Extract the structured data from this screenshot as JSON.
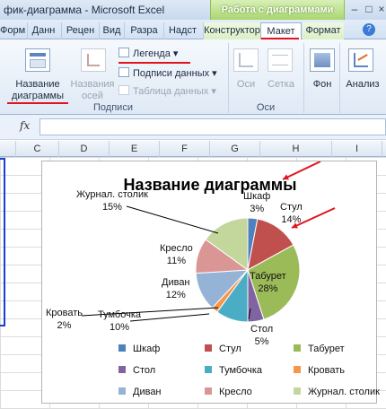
{
  "window": {
    "title": "фик-диаграмма  -  Microsoft Excel",
    "context_group": "Работа с диаграммами"
  },
  "tabs": [
    "Форм",
    "Данн",
    "Рецен",
    "Вид",
    "Разра",
    "Надст",
    "Конструктор",
    "Макет",
    "Формат"
  ],
  "active_tab": "Макет",
  "ribbon": {
    "chart_title_btn": "Название диаграммы",
    "axis_title_btn": "Названия осей",
    "legend": "Легенда",
    "data_labels": "Подписи данных",
    "data_table": "Таблица данных",
    "group_labels": "Подписи",
    "axes_btn": "Оси",
    "grid_btn": "Сетка",
    "group_axes": "Оси",
    "background_btn": "Фон",
    "analysis_btn": "Анализ"
  },
  "formula_bar": {
    "fx": "fx",
    "value": ""
  },
  "columns": [
    "C",
    "D",
    "E",
    "F",
    "G",
    "H",
    "I"
  ],
  "icons": [
    "win-minimize-icon",
    "win-maximize-icon",
    "win-close-icon",
    "help-icon",
    "chart-title-icon",
    "axis-title-icon",
    "legend-icon",
    "data-labels-icon",
    "data-table-icon",
    "axes-icon",
    "grid-icon",
    "background-icon",
    "analysis-icon",
    "red-arrow-icon"
  ],
  "chart_data": {
    "type": "pie",
    "title": "Название диаграммы",
    "slices": [
      {
        "name": "Шкаф",
        "percent": 3,
        "label": "3%",
        "color": "#4f81bd"
      },
      {
        "name": "Стул",
        "percent": 14,
        "label": "14%",
        "color": "#c0504d"
      },
      {
        "name": "Табурет",
        "percent": 28,
        "label": "28%",
        "color": "#9bbb59"
      },
      {
        "name": "Стол",
        "percent": 5,
        "label": "5%",
        "color": "#8064a2"
      },
      {
        "name": "Тумбочка",
        "percent": 10,
        "label": "10%",
        "color": "#4bacc6"
      },
      {
        "name": "Кровать",
        "percent": 2,
        "label": "2%",
        "color": "#f79646"
      },
      {
        "name": "Диван",
        "percent": 12,
        "label": "12%",
        "color": "#95b3d7"
      },
      {
        "name": "Кресло",
        "percent": 11,
        "label": "11%",
        "color": "#d99694"
      },
      {
        "name": "Журнал. столик",
        "percent": 15,
        "label": "15%",
        "color": "#c3d69b"
      }
    ],
    "legend_position": "bottom"
  },
  "colors": {
    "annotation": "#e0141d",
    "context_accent": "#9bbb59"
  }
}
